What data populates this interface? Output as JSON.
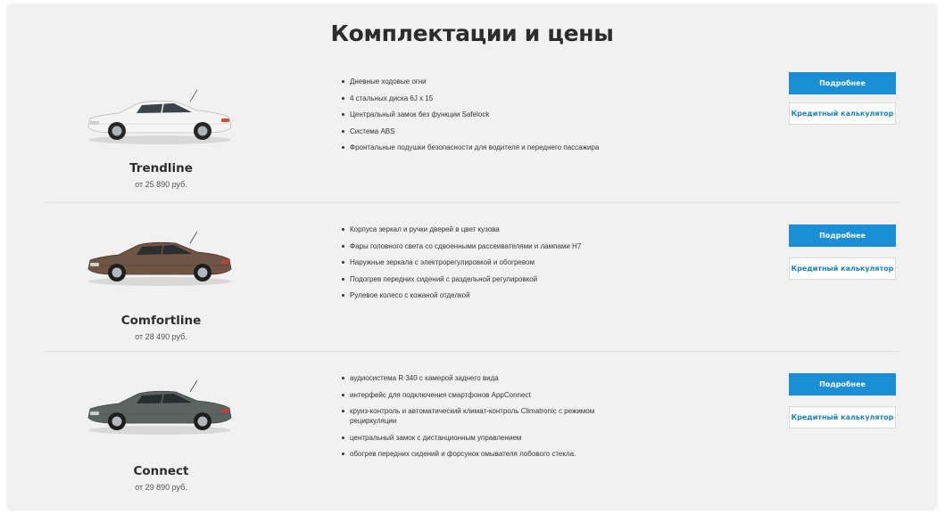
{
  "section": {
    "title": "Комплектации и цены"
  },
  "buttons": {
    "details_label": "Подробнее",
    "calc_label": "Кредитный калькулятор"
  },
  "trims": [
    {
      "name": "Trendline",
      "price": "от 25 890 руб.",
      "car_color": "#f4f4f4",
      "features": [
        "Дневные ходовые огни",
        "4 стальных диска 6J x 15",
        "Центральный замок без функции Safelock",
        "Система ABS",
        "Фронтальные подушки безопасности для водителя и переднего пассажира"
      ]
    },
    {
      "name": "Comfortline",
      "price": "от 28 490 руб.",
      "car_color": "#6e5544",
      "features": [
        "Корпуса зеркал и ручки дверей в цвет кузова",
        "Фары головного света со сдвоенными рассеивателями и лампами H7",
        "Наружные зеркала с электрорегулировкой и обогревом",
        "Подогрев передних сидений с раздельной регулировкой",
        "Рулевое колесо с кожаной отделкой"
      ]
    },
    {
      "name": "Connect",
      "price": "от 29 890 руб.",
      "car_color": "#5c6462",
      "features": [
        "аудиосистема R 340 с камерой заднего вида",
        "интерфейс для подключения смартфонов AppConnect",
        "круиз-контроль и автоматический климат-контроль Climatronic с режимом рециркуляции",
        "центральный замок с дистанционным управлением",
        "обогрев передних сидений и форсунок омывателя лобового стекла."
      ]
    }
  ]
}
